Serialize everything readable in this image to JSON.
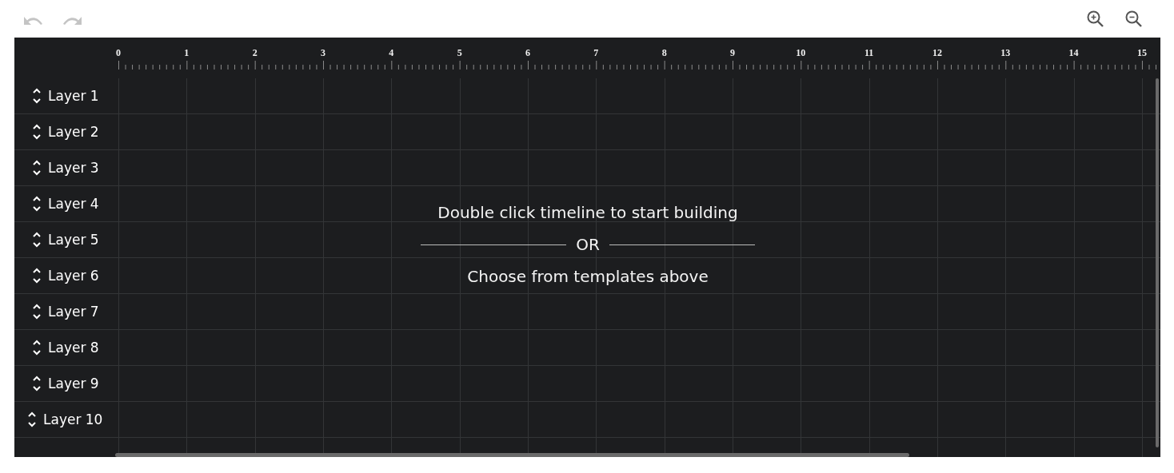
{
  "toolbar": {
    "undo": {
      "disabled": true
    },
    "redo": {
      "disabled": true
    }
  },
  "ruler": {
    "labels": [
      "0",
      "1",
      "2",
      "3",
      "4",
      "5",
      "6",
      "7",
      "8",
      "9",
      "10",
      "11",
      "12",
      "13",
      "14",
      "15"
    ]
  },
  "layers": [
    {
      "label": "Layer 1"
    },
    {
      "label": "Layer 2"
    },
    {
      "label": "Layer 3"
    },
    {
      "label": "Layer 4"
    },
    {
      "label": "Layer 5"
    },
    {
      "label": "Layer 6"
    },
    {
      "label": "Layer 7"
    },
    {
      "label": "Layer 8"
    },
    {
      "label": "Layer 9"
    },
    {
      "label": "Layer 10"
    }
  ],
  "empty_state": {
    "headline": "Double click timeline to start building",
    "separator": "OR",
    "hint": "Choose from templates above"
  }
}
